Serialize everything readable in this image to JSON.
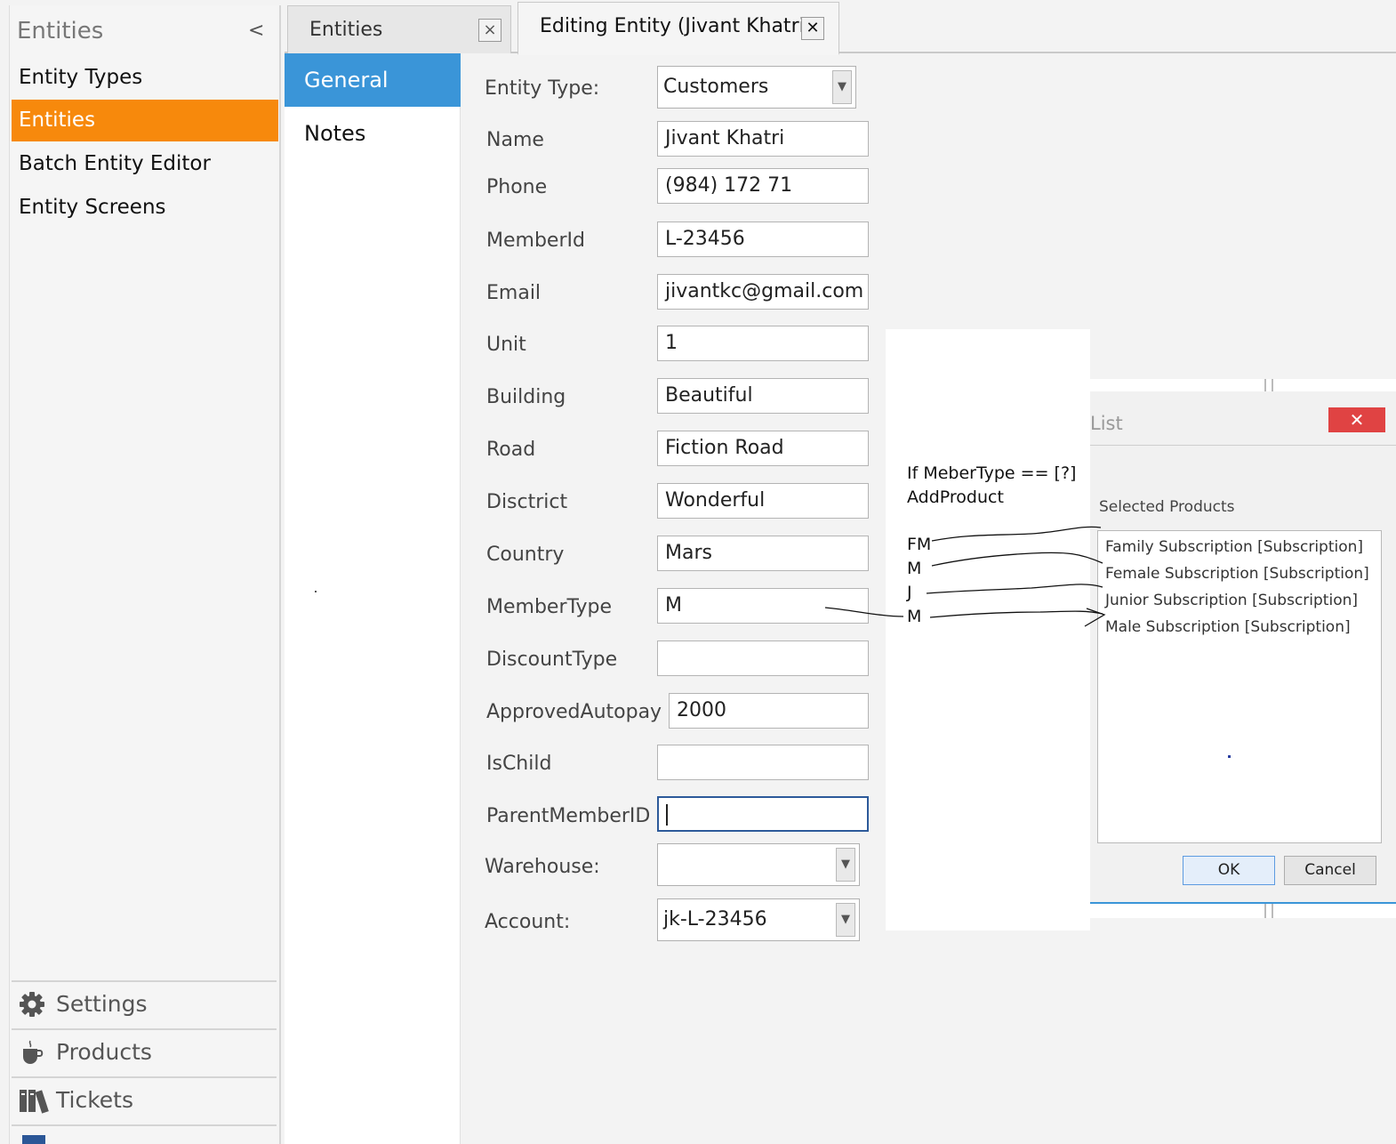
{
  "sidebar": {
    "header": "Entities",
    "collapse_glyph": "<",
    "items": [
      {
        "label": "Entity Types"
      },
      {
        "label": "Entities",
        "active": true
      },
      {
        "label": "Batch Entity Editor"
      },
      {
        "label": "Entity Screens"
      }
    ],
    "bottom": [
      {
        "label": "Settings",
        "icon": "gear-icon"
      },
      {
        "label": "Products",
        "icon": "coffee-cup-icon"
      },
      {
        "label": "Tickets",
        "icon": "books-icon"
      }
    ]
  },
  "tabs": [
    {
      "label": "Entities",
      "close": "×"
    },
    {
      "label": "Editing Entity (Jivant Khatri)",
      "close": "✕",
      "active": true
    }
  ],
  "subnav": [
    {
      "label": "General",
      "active": true
    },
    {
      "label": "Notes"
    }
  ],
  "form": {
    "entity_type": {
      "label": "Entity Type:",
      "value": "Customers"
    },
    "fields": [
      {
        "label": "Name",
        "value": "Jivant Khatri"
      },
      {
        "label": "Phone",
        "value": "(984) 172 71"
      },
      {
        "label": "MemberId",
        "value": "L-23456"
      },
      {
        "label": "Email",
        "value": "jivantkc@gmail.com"
      },
      {
        "label": "Unit",
        "value": "1"
      },
      {
        "label": "Building",
        "value": "Beautiful"
      },
      {
        "label": "Road",
        "value": "Fiction Road"
      },
      {
        "label": "Disctrict",
        "value": "Wonderful"
      },
      {
        "label": "Country",
        "value": "Mars"
      },
      {
        "label": "MemberType",
        "value": "M"
      },
      {
        "label": "DiscountType",
        "value": ""
      },
      {
        "label": "ApprovedAutopay",
        "value": "2000"
      },
      {
        "label": "IsChild",
        "value": ""
      },
      {
        "label": "ParentMemberID",
        "value": ""
      }
    ],
    "warehouse": {
      "label": "Warehouse:",
      "value": ""
    },
    "account": {
      "label": "Account:",
      "value": "jk-L-23456"
    }
  },
  "annotation": {
    "line1": "If MeberType == [?]",
    "line2": "AddProduct",
    "codes": [
      "FM",
      "M",
      "J",
      "M"
    ]
  },
  "dialog": {
    "title": "List",
    "close": "✕",
    "list_label": "Selected Products",
    "items": [
      "Family Subscription [Subscription]",
      "Female Subscription [Subscription]",
      "Junior Subscription [Subscription]",
      "Male Subscription [Subscription]"
    ],
    "ok": "OK",
    "cancel": "Cancel"
  },
  "colors": {
    "accent_orange": "#f7890c",
    "accent_blue": "#3a95d8",
    "close_red": "#e04343"
  }
}
